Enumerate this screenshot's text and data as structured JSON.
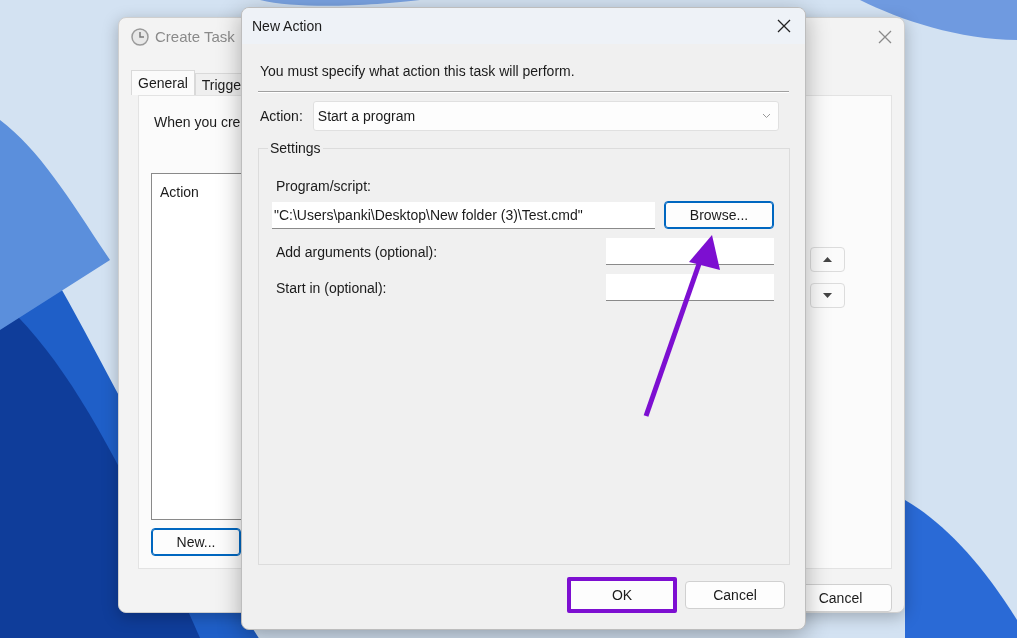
{
  "create_task_window": {
    "title": "Create Task",
    "tabs": [
      {
        "label": "General",
        "selected": true
      },
      {
        "label": "Trigge",
        "selected": false
      }
    ],
    "intro_text": "When you cre",
    "actions_list": {
      "column": "Action"
    },
    "new_button": {
      "label": "New...",
      "default": true
    },
    "cancel_button": {
      "label": "Cancel",
      "default": false
    }
  },
  "new_action_dialog": {
    "title": "New Action",
    "instruction": "You must specify what action this task will perform.",
    "action_label": "Action:",
    "action_value": "Start a program",
    "settings": {
      "title": "Settings",
      "program_label": "Program/script:",
      "program_value": "\"C:\\Users\\panki\\Desktop\\New folder (3)\\Test.cmd\"",
      "browse_button": {
        "label": "Browse...",
        "default": true
      },
      "fields": [
        {
          "label": "Add arguments (optional):"
        },
        {
          "label": "Start in (optional):"
        }
      ]
    },
    "ok_button": {
      "label": "OK",
      "default": false,
      "highlighted": true
    },
    "cancel_button": {
      "label": "Cancel",
      "default": false
    }
  }
}
